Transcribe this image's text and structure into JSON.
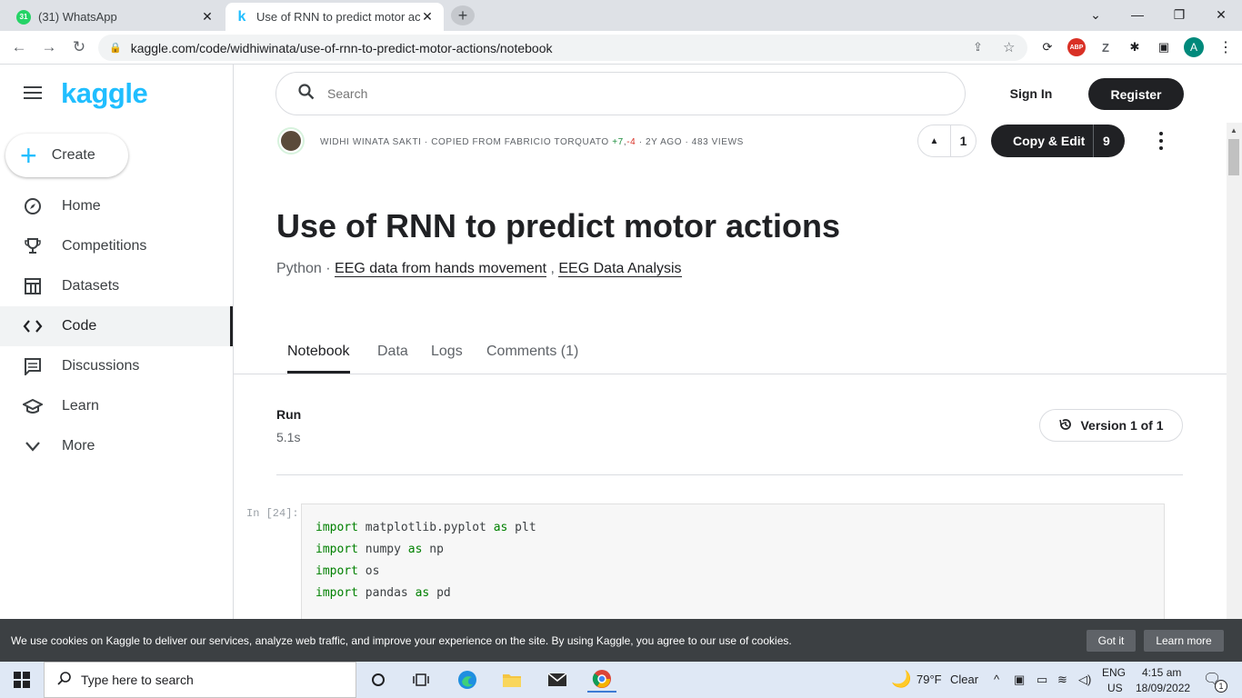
{
  "browser": {
    "tabs": [
      {
        "title": "(31) WhatsApp",
        "badge": "31"
      },
      {
        "title": "Use of RNN to predict motor actio"
      }
    ],
    "url": "kaggle.com/code/widhiwinata/use-of-rnn-to-predict-motor-actions/notebook",
    "profile_initial": "A"
  },
  "sidebar": {
    "logo": "kaggle",
    "create_label": "Create",
    "items": [
      {
        "label": "Home",
        "icon": "compass-icon"
      },
      {
        "label": "Competitions",
        "icon": "trophy-icon"
      },
      {
        "label": "Datasets",
        "icon": "table-icon"
      },
      {
        "label": "Code",
        "icon": "code-icon"
      },
      {
        "label": "Discussions",
        "icon": "comment-icon"
      },
      {
        "label": "Learn",
        "icon": "school-icon"
      },
      {
        "label": "More",
        "icon": "chevron-down-icon"
      }
    ]
  },
  "header": {
    "search_placeholder": "Search",
    "signin": "Sign In",
    "register": "Register"
  },
  "notebook": {
    "meta_author": "WIDHI WINATA SAKTI · COPIED FROM FABRICIO TORQUATO",
    "meta_plus": "+7",
    "meta_sep": ",",
    "meta_minus": "-4",
    "meta_rest": "· 2Y AGO · 483 VIEWS",
    "upvotes": "1",
    "copy_edit": "Copy & Edit",
    "copy_count": "9",
    "title": "Use of RNN to predict motor actions",
    "language": "Python",
    "dot": " · ",
    "tag1": "EEG data from hands movement",
    "tag_sep": " , ",
    "tag2": "EEG Data Analysis",
    "tabs": [
      "Notebook",
      "Data",
      "Logs",
      "Comments (1)"
    ],
    "run_label": "Run",
    "run_time": "5.1s",
    "version": "Version 1 of 1",
    "cell_prompt": "In [24]:",
    "code": [
      {
        "kw": "import",
        "rest": " matplotlib.pyplot ",
        "kw2": "as",
        "rest2": " plt"
      },
      {
        "kw": "import",
        "rest": " numpy ",
        "kw2": "as",
        "rest2": " np"
      },
      {
        "kw": "import",
        "rest": " os",
        "kw2": "",
        "rest2": ""
      },
      {
        "kw": "import",
        "rest": " pandas ",
        "kw2": "as",
        "rest2": " pd"
      }
    ]
  },
  "cookie": {
    "text": "We use cookies on Kaggle to deliver our services, analyze web traffic, and improve your experience on the site. By using Kaggle, you agree to our use of cookies.",
    "got_it": "Got it",
    "learn_more": "Learn more"
  },
  "taskbar": {
    "search_placeholder": "Type here to search",
    "weather_temp": "79°F",
    "weather_desc": "Clear",
    "lang": "ENG",
    "region": "US",
    "time": "4:15 am",
    "date": "18/09/2022",
    "notif_count": "1"
  }
}
